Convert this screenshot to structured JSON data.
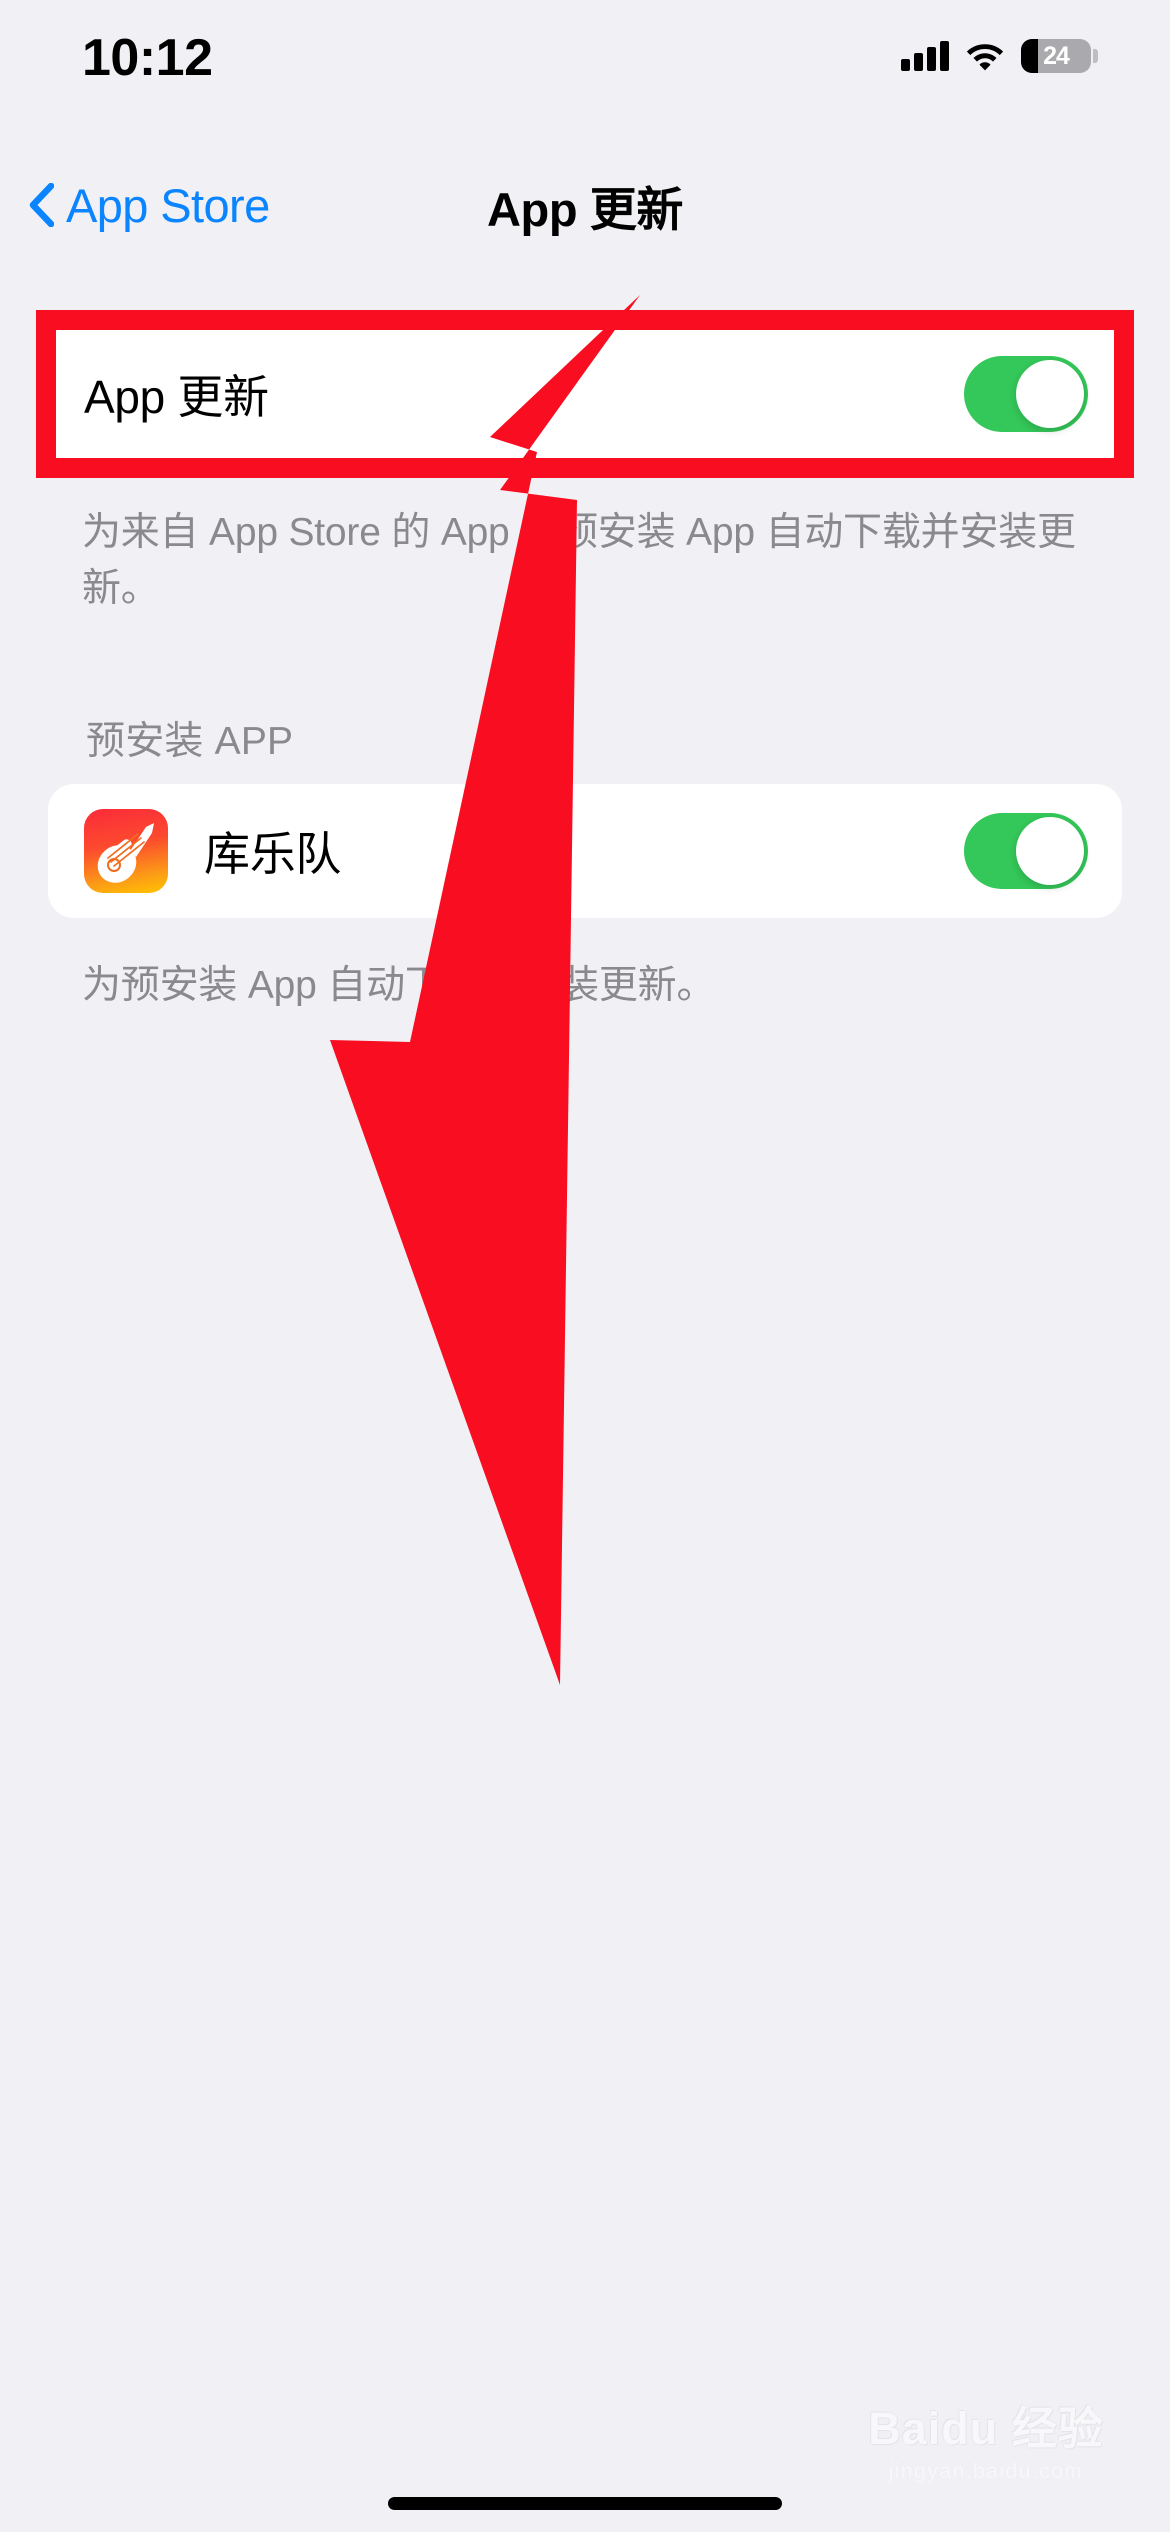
{
  "status_bar": {
    "time": "10:12",
    "cellular_icon": "cellular-bars-icon",
    "wifi_icon": "wifi-icon",
    "battery_percent": "24",
    "battery_level": 24
  },
  "nav": {
    "back_label": "App Store",
    "back_icon": "chevron-left-icon",
    "title": "App 更新"
  },
  "sections": [
    {
      "header": "",
      "rows": [
        {
          "label": "App 更新",
          "toggle_on": true,
          "highlighted": true
        }
      ],
      "footer": "为来自 App Store 的 App 及预安装 App 自动下载并安装更新。"
    },
    {
      "header": "预安装 APP",
      "rows": [
        {
          "label": "库乐队",
          "icon": "garageband-app-icon",
          "toggle_on": true,
          "highlighted": false
        }
      ],
      "footer": "为预安装 App 自动下载并安装更新。"
    }
  ],
  "annotations": {
    "highlight_color": "#F80D21",
    "arrow_color": "#F80D21",
    "arrow_name": "red-callout-arrow",
    "rect_name": "red-highlight-rectangle"
  },
  "watermark": {
    "brand": "Baidu 经验",
    "url": "jingyan.baidu.com"
  },
  "colors": {
    "background": "#F1F1F5",
    "card": "#FFFFFF",
    "accent_blue": "#0A84FF",
    "toggle_green": "#34C759",
    "secondary_text": "#8A8A8E"
  },
  "home_indicator": "home-indicator"
}
